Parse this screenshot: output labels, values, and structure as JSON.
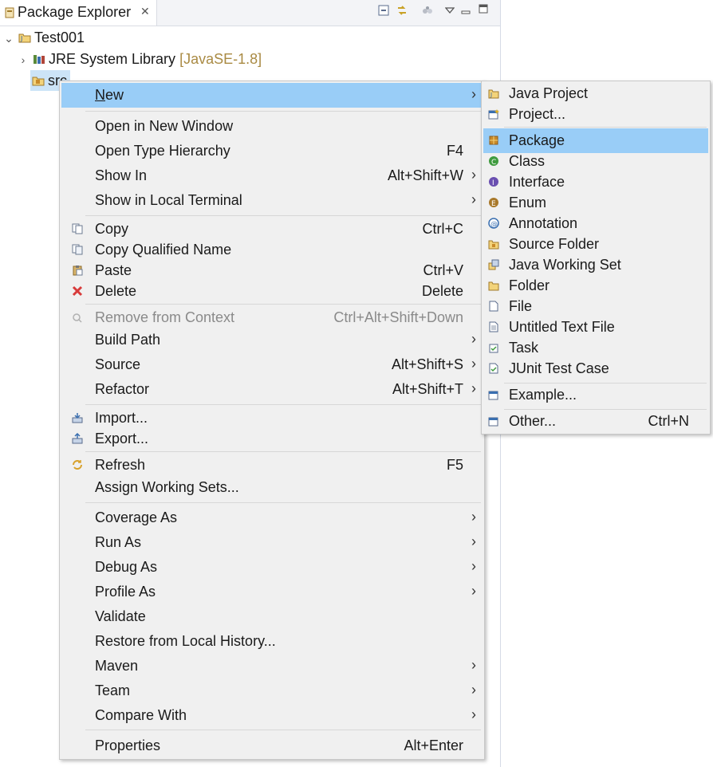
{
  "view": {
    "tab_title": "Package Explorer",
    "close_glyph": "✕"
  },
  "tree": {
    "project": "Test001",
    "jre": "JRE System Library",
    "jre_decor": "[JavaSE-1.8]",
    "src": "src"
  },
  "menu": {
    "items": [
      {
        "label": "New",
        "arrow": "›"
      },
      {
        "label": "Open in New Window"
      },
      {
        "label": "Open Type Hierarchy",
        "shortcut": "F4"
      },
      {
        "label": "Show In",
        "shortcut": "Alt+Shift+W",
        "arrow": "›"
      },
      {
        "label": "Show in Local Terminal",
        "arrow": "›"
      },
      {
        "label": "Copy",
        "shortcut": "Ctrl+C"
      },
      {
        "label": "Copy Qualified Name"
      },
      {
        "label": "Paste",
        "shortcut": "Ctrl+V"
      },
      {
        "label": "Delete",
        "shortcut": "Delete"
      },
      {
        "label": "Remove from Context",
        "shortcut": "Ctrl+Alt+Shift+Down"
      },
      {
        "label": "Build Path",
        "arrow": "›"
      },
      {
        "label": "Source",
        "shortcut": "Alt+Shift+S",
        "arrow": "›"
      },
      {
        "label": "Refactor",
        "shortcut": "Alt+Shift+T",
        "arrow": "›"
      },
      {
        "label": "Import..."
      },
      {
        "label": "Export..."
      },
      {
        "label": "Refresh",
        "shortcut": "F5"
      },
      {
        "label": "Assign Working Sets..."
      },
      {
        "label": "Coverage As",
        "arrow": "›"
      },
      {
        "label": "Run As",
        "arrow": "›"
      },
      {
        "label": "Debug As",
        "arrow": "›"
      },
      {
        "label": "Profile As",
        "arrow": "›"
      },
      {
        "label": "Validate"
      },
      {
        "label": "Restore from Local History..."
      },
      {
        "label": "Maven",
        "arrow": "›"
      },
      {
        "label": "Team",
        "arrow": "›"
      },
      {
        "label": "Compare With",
        "arrow": "›"
      },
      {
        "label": "Properties",
        "shortcut": "Alt+Enter"
      }
    ]
  },
  "submenu": {
    "items": [
      {
        "label": "Java Project"
      },
      {
        "label": "Project..."
      },
      {
        "label": "Package"
      },
      {
        "label": "Class"
      },
      {
        "label": "Interface"
      },
      {
        "label": "Enum"
      },
      {
        "label": "Annotation"
      },
      {
        "label": "Source Folder"
      },
      {
        "label": "Java Working Set"
      },
      {
        "label": "Folder"
      },
      {
        "label": "File"
      },
      {
        "label": "Untitled Text File"
      },
      {
        "label": "Task"
      },
      {
        "label": "JUnit Test Case"
      },
      {
        "label": "Example..."
      },
      {
        "label": "Other...",
        "shortcut": "Ctrl+N"
      }
    ]
  },
  "colors": {
    "highlight": "#99cdf7",
    "selection": "#cce4f7",
    "decorator": "#a98a43"
  }
}
